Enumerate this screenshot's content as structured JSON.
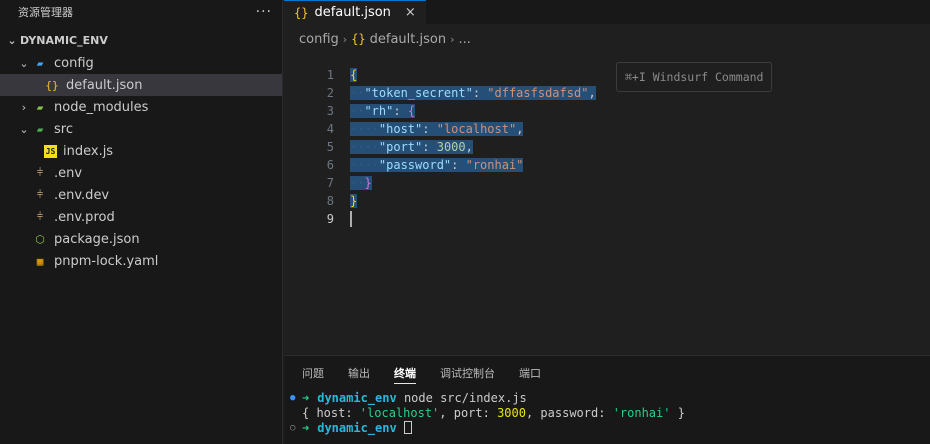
{
  "sidebar": {
    "title": "资源管理器",
    "more": "···",
    "project": "DYNAMIC_ENV",
    "items": [
      {
        "label": "config",
        "indent": 1,
        "chevron": "v",
        "icon": "folder-config-icon",
        "glyph": "▰",
        "color": "#42a5f5"
      },
      {
        "label": "default.json",
        "indent": 2,
        "chevron": "",
        "icon": "json-icon",
        "glyph": "{}",
        "color": "#f5c033",
        "selected": true
      },
      {
        "label": "node_modules",
        "indent": 1,
        "chevron": ">",
        "icon": "folder-node-icon",
        "glyph": "▰",
        "color": "#8bc34a"
      },
      {
        "label": "src",
        "indent": 1,
        "chevron": "v",
        "icon": "folder-src-icon",
        "glyph": "▰",
        "color": "#4caf50"
      },
      {
        "label": "index.js",
        "indent": 2,
        "chevron": "",
        "icon": "javascript-icon",
        "glyph": "JS",
        "color": "#f5de19"
      },
      {
        "label": ".env",
        "indent": 1,
        "chevron": "",
        "icon": "env-icon",
        "glyph": "⫩",
        "color": "#e2c08d"
      },
      {
        "label": ".env.dev",
        "indent": 1,
        "chevron": "",
        "icon": "env-icon",
        "glyph": "⫩",
        "color": "#e2c08d"
      },
      {
        "label": ".env.prod",
        "indent": 1,
        "chevron": "",
        "icon": "env-icon",
        "glyph": "⫩",
        "color": "#e2c08d"
      },
      {
        "label": "package.json",
        "indent": 1,
        "chevron": "",
        "icon": "nodejs-icon",
        "glyph": "⬡",
        "color": "#8bc34a"
      },
      {
        "label": "pnpm-lock.yaml",
        "indent": 1,
        "chevron": "",
        "icon": "pnpm-icon",
        "glyph": "▦",
        "color": "#f9ad00"
      }
    ]
  },
  "editor": {
    "tab_icon": "{}",
    "tab_label": "default.json",
    "tab_close": "×",
    "breadcrumb": [
      "config",
      "default.json",
      "..."
    ],
    "breadcrumb_icon": "{}",
    "hint": "⌘+I Windsurf Command",
    "line_numbers": [
      "1",
      "2",
      "3",
      "4",
      "5",
      "6",
      "7",
      "8",
      "9"
    ],
    "code": {
      "l1": "{",
      "l2_key": "\"token_secrent\"",
      "l2_val": "\"dffasfsdafsd\"",
      "l3_key": "\"rh\"",
      "l3_brace": "{",
      "l4_key": "\"host\"",
      "l4_val": "\"localhost\"",
      "l5_key": "\"port\"",
      "l5_val": "3000",
      "l6_key": "\"password\"",
      "l6_val": "\"ronhai\"",
      "l7": "}",
      "l8": "}",
      "colon": ": ",
      "comma": ","
    }
  },
  "panel": {
    "tabs": [
      "问题",
      "输出",
      "终端",
      "调试控制台",
      "端口"
    ],
    "active_tab": "终端",
    "terminal": {
      "prompt_arrow": "➜",
      "cwd": "dynamic_env",
      "command": "node src/index.js",
      "output": {
        "open": "{ host: ",
        "host": "'localhost'",
        "port_label": ", port: ",
        "port": "3000",
        "pw_label": ", password: ",
        "password": "'ronhai'",
        "close": " }"
      }
    }
  },
  "colors": {
    "accent": "#0078d4",
    "selection": "#264f78"
  }
}
